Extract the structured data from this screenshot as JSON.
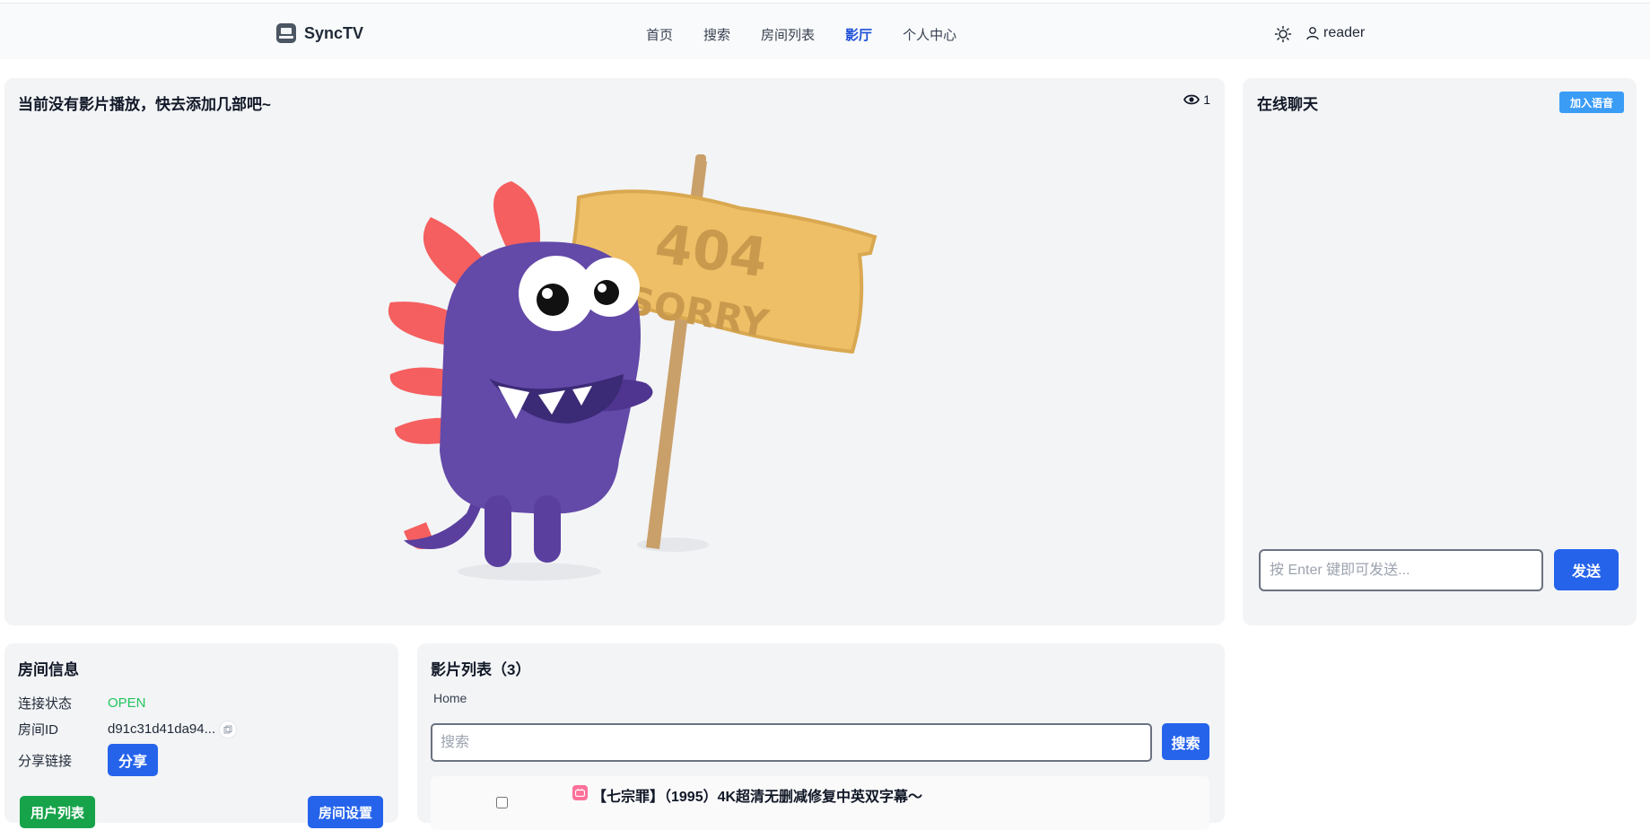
{
  "header": {
    "brand": "SyncTV",
    "nav": [
      "首页",
      "搜索",
      "房间列表",
      "影厅",
      "个人中心"
    ],
    "active_nav": "影厅",
    "username": "reader"
  },
  "player": {
    "title": "当前没有影片播放，快去添加几部吧~",
    "viewer_count": "1",
    "sign_line1": "404",
    "sign_line2": "SORRY"
  },
  "chat": {
    "title": "在线聊天",
    "voice_button": "加入语音",
    "input_placeholder": "按 Enter 键即可发送...",
    "send_button": "发送"
  },
  "room_info": {
    "title": "房间信息",
    "status_label": "连接状态",
    "status_value": "OPEN",
    "id_label": "房间ID",
    "id_value": "d91c31d41da94...",
    "share_label": "分享链接",
    "share_button": "分享",
    "users_button": "用户列表",
    "settings_button": "房间设置"
  },
  "movie_list": {
    "title": "影片列表（3）",
    "breadcrumb": "Home",
    "search_placeholder": "搜索",
    "search_button": "搜索",
    "items": [
      {
        "title": "【七宗罪】（1995）4K超清无删减修复中英双字幕～"
      }
    ]
  },
  "colors": {
    "accent": "#2563eb",
    "active_nav": "#1d4ed8",
    "status_open": "#22c55e",
    "voice_button": "#3b9cf6",
    "users_button": "#16a34a"
  }
}
